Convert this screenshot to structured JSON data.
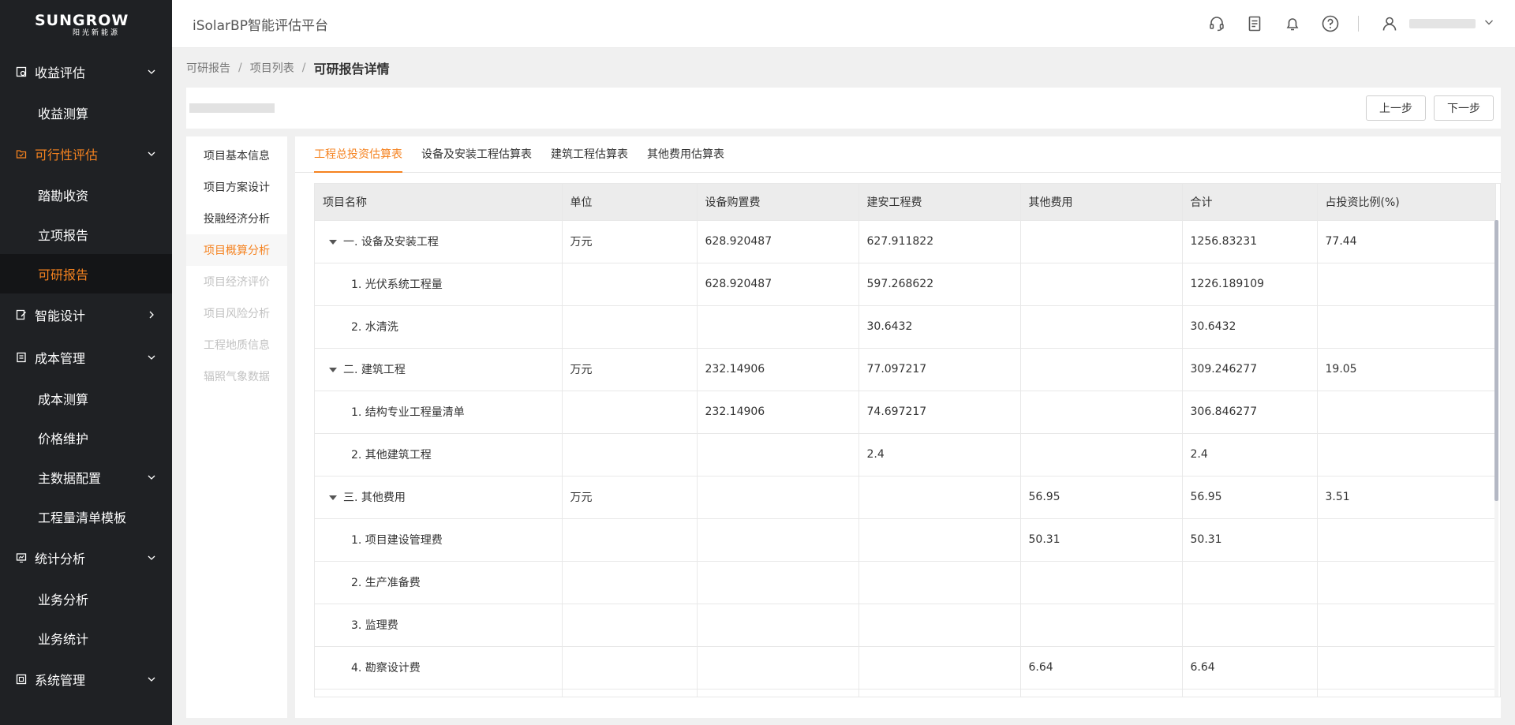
{
  "brand": {
    "logo_main": "SUNGROW",
    "logo_sub": "阳光新能源"
  },
  "header": {
    "app_title": "iSolarBP智能评估平台"
  },
  "sidebar": {
    "groups": [
      {
        "label": "收益评估",
        "icon": "gauge-icon",
        "children": [
          "收益测算"
        ]
      },
      {
        "label": "可行性评估",
        "icon": "folder-check-icon",
        "children": [
          "踏勘收资",
          "立项报告",
          "可研报告"
        ]
      },
      {
        "label": "智能设计",
        "icon": "edit-icon",
        "children": []
      },
      {
        "label": "成本管理",
        "icon": "ledger-icon",
        "children": [
          "成本测算",
          "价格维护",
          "主数据配置",
          "工程量清单模板"
        ]
      },
      {
        "label": "统计分析",
        "icon": "monitor-chart-icon",
        "children": [
          "业务分析",
          "业务统计"
        ]
      },
      {
        "label": "系统管理",
        "icon": "panel-icon",
        "children": []
      }
    ],
    "active_item": "可研报告"
  },
  "breadcrumb": {
    "items": [
      "可研报告",
      "项目列表"
    ],
    "current": "可研报告详情"
  },
  "topbar": {
    "prev": "上一步",
    "next": "下一步"
  },
  "subnav": {
    "items": [
      "项目基本信息",
      "项目方案设计",
      "投融经济分析",
      "项目概算分析",
      "项目经济评价",
      "项目风险分析",
      "工程地质信息",
      "辐照气象数据"
    ],
    "active": "项目概算分析"
  },
  "tabs": [
    "工程总投资估算表",
    "设备及安装工程估算表",
    "建筑工程估算表",
    "其他费用估算表"
  ],
  "table": {
    "columns": [
      "项目名称",
      "单位",
      "设备购置费",
      "建安工程费",
      "其他费用",
      "合计",
      "占投资比例(%)"
    ],
    "rows": [
      {
        "name": "一. 设备及安装工程",
        "unit": "万元",
        "equip": "628.920487",
        "install": "627.911822",
        "other": "",
        "total": "1256.83231",
        "ratio": "77.44",
        "parent": true
      },
      {
        "name": "1. 光伏系统工程量",
        "unit": "",
        "equip": "628.920487",
        "install": "597.268622",
        "other": "",
        "total": "1226.189109",
        "ratio": "",
        "parent": false
      },
      {
        "name": "2. 水清洗",
        "unit": "",
        "equip": "",
        "install": "30.6432",
        "other": "",
        "total": "30.6432",
        "ratio": "",
        "parent": false
      },
      {
        "name": "二. 建筑工程",
        "unit": "万元",
        "equip": "232.14906",
        "install": "77.097217",
        "other": "",
        "total": "309.246277",
        "ratio": "19.05",
        "parent": true
      },
      {
        "name": "1. 结构专业工程量清单",
        "unit": "",
        "equip": "232.14906",
        "install": "74.697217",
        "other": "",
        "total": "306.846277",
        "ratio": "",
        "parent": false
      },
      {
        "name": "2. 其他建筑工程",
        "unit": "",
        "equip": "",
        "install": "2.4",
        "other": "",
        "total": "2.4",
        "ratio": "",
        "parent": false
      },
      {
        "name": "三. 其他费用",
        "unit": "万元",
        "equip": "",
        "install": "",
        "other": "56.95",
        "total": "56.95",
        "ratio": "3.51",
        "parent": true
      },
      {
        "name": "1. 项目建设管理费",
        "unit": "",
        "equip": "",
        "install": "",
        "other": "50.31",
        "total": "50.31",
        "ratio": "",
        "parent": false
      },
      {
        "name": "2. 生产准备费",
        "unit": "",
        "equip": "",
        "install": "",
        "other": "",
        "total": "",
        "ratio": "",
        "parent": false
      },
      {
        "name": "3. 监理费",
        "unit": "",
        "equip": "",
        "install": "",
        "other": "",
        "total": "",
        "ratio": "",
        "parent": false
      },
      {
        "name": "4. 勘察设计费",
        "unit": "",
        "equip": "",
        "install": "",
        "other": "6.64",
        "total": "6.64",
        "ratio": "",
        "parent": false
      },
      {
        "name": "",
        "unit": "",
        "equip": "",
        "install": "",
        "other": "",
        "total": "",
        "ratio": "",
        "parent": false
      }
    ]
  },
  "colors": {
    "accent": "#f5821f",
    "sidebar_bg": "#1f2124",
    "active_bg": "#141517"
  }
}
